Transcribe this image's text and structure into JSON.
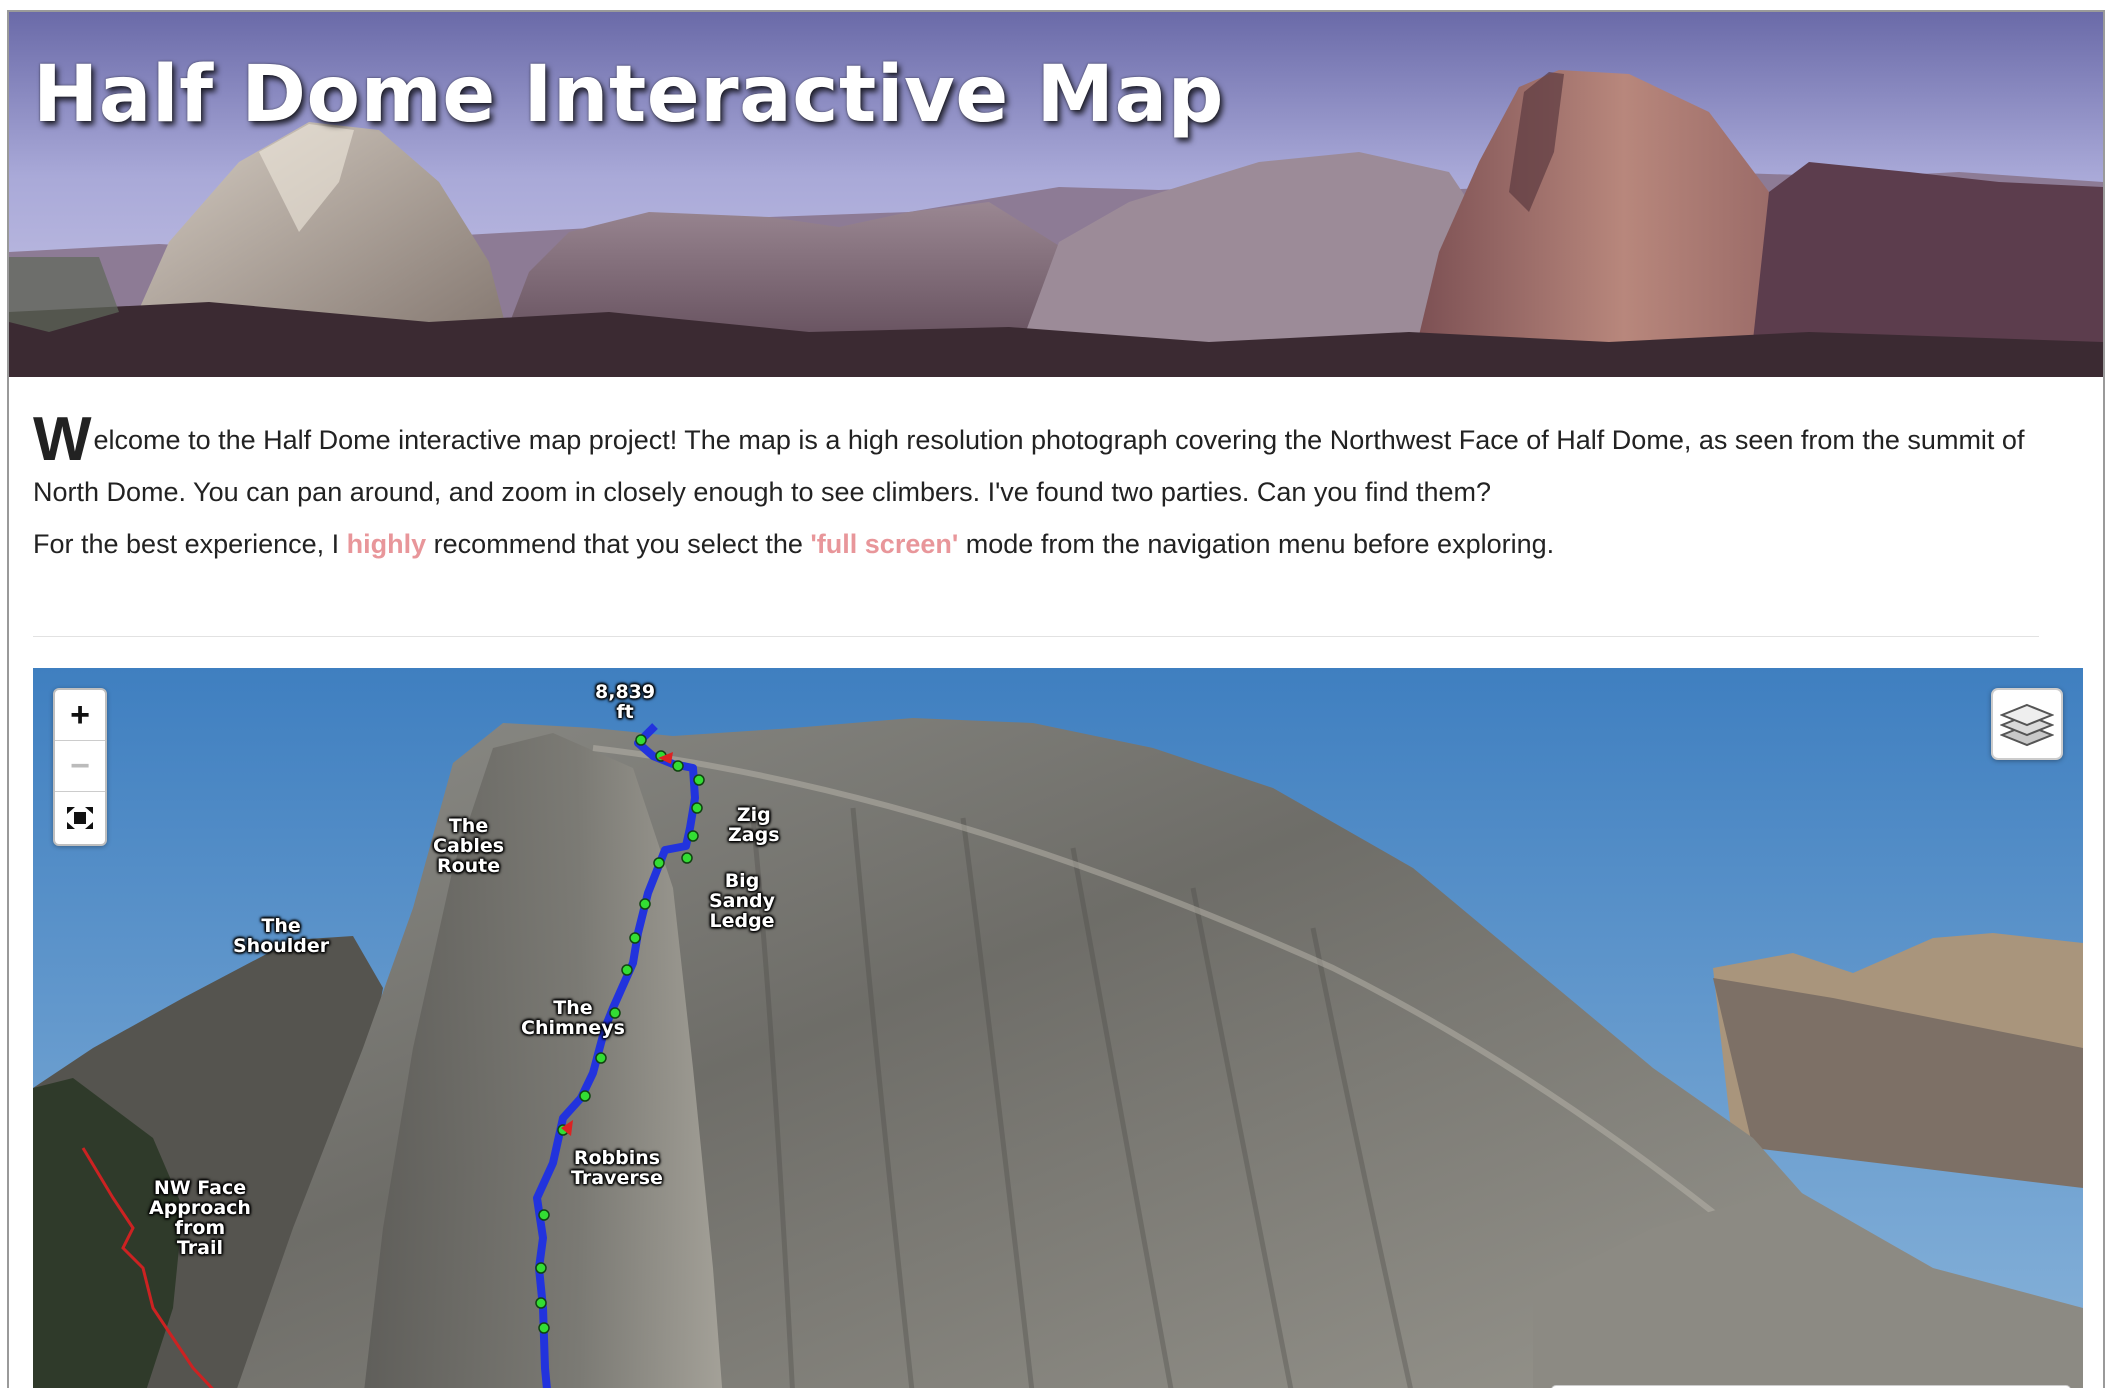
{
  "banner": {
    "title": "Half Dome Interactive Map"
  },
  "intro": {
    "dropcap": "W",
    "paragraph1_rest": "elcome to the Half Dome interactive map project! The map is a high resolution photograph covering the Northwest Face of Half Dome, as seen from the summit of North Dome. You can pan around, and zoom in closely enough to see climbers. I've found two parties. Can you find them?",
    "p2_part1": "For the best experience, I ",
    "p2_highlight1": "highly",
    "p2_part2": " recommend that you select the ",
    "p2_highlight2": "'full screen'",
    "p2_part3": " mode from the navigation menu before exploring.",
    "highlight_color": "#e8969a"
  },
  "map": {
    "controls": {
      "zoom_in": "+",
      "zoom_out": "−",
      "fullscreen_icon": "fullscreen-icon",
      "layers_icon": "layers-icon"
    },
    "labels": {
      "summit": "8,839\nft",
      "zig_zags": "Zig\nZags",
      "cables": "The\nCables\nRoute",
      "big_sandy": "Big\nSandy\nLedge",
      "shoulder": "The\nShoulder",
      "chimneys": "The\nChimneys",
      "robbins": "Robbins\nTraverse",
      "approach": "NW Face\nApproach\nfrom\nTrail"
    },
    "colors": {
      "route": "#2233dd",
      "belay": "#33dd33",
      "approach": "#cc2222",
      "sky": "#4a86c4"
    }
  }
}
